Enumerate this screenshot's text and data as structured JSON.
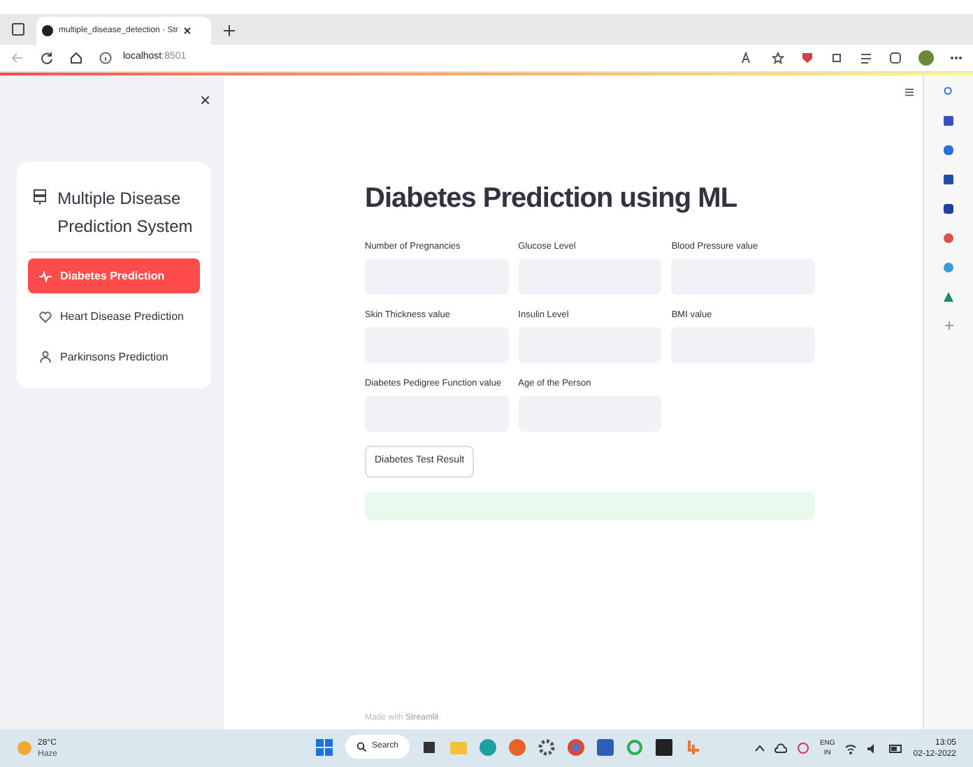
{
  "browser": {
    "tab_title": "multiple_disease_detection · Str",
    "url_host": "localhost",
    "url_port": ":8501"
  },
  "sidebar": {
    "close": "×",
    "title": "Multiple Disease Prediction System",
    "items": [
      {
        "label": "Diabetes Prediction",
        "kind": "pulse",
        "selected": true
      },
      {
        "label": "Heart Disease Prediction",
        "kind": "heart",
        "selected": false
      },
      {
        "label": "Parkinsons Prediction",
        "kind": "person",
        "selected": false
      }
    ]
  },
  "main": {
    "menu": "≡",
    "title": "Diabetes Prediction using ML",
    "fields": [
      {
        "label": "Number of Pregnancies"
      },
      {
        "label": "Glucose Level"
      },
      {
        "label": "Blood Pressure value"
      },
      {
        "label": "Skin Thickness value"
      },
      {
        "label": "Insulin Level"
      },
      {
        "label": "BMI value"
      },
      {
        "label": "Diabetes Pedigree Function value"
      },
      {
        "label": "Age of the Person"
      }
    ],
    "button": "Diabetes Test Result",
    "footer_prefix": "Made with",
    "footer_brand": "Streamlit"
  },
  "taskbar": {
    "temperature": "28°C",
    "weather": "Haze",
    "search": "Search",
    "lang": "ENG",
    "region": "IN",
    "time": "13:05",
    "date": "02-12-2022"
  }
}
